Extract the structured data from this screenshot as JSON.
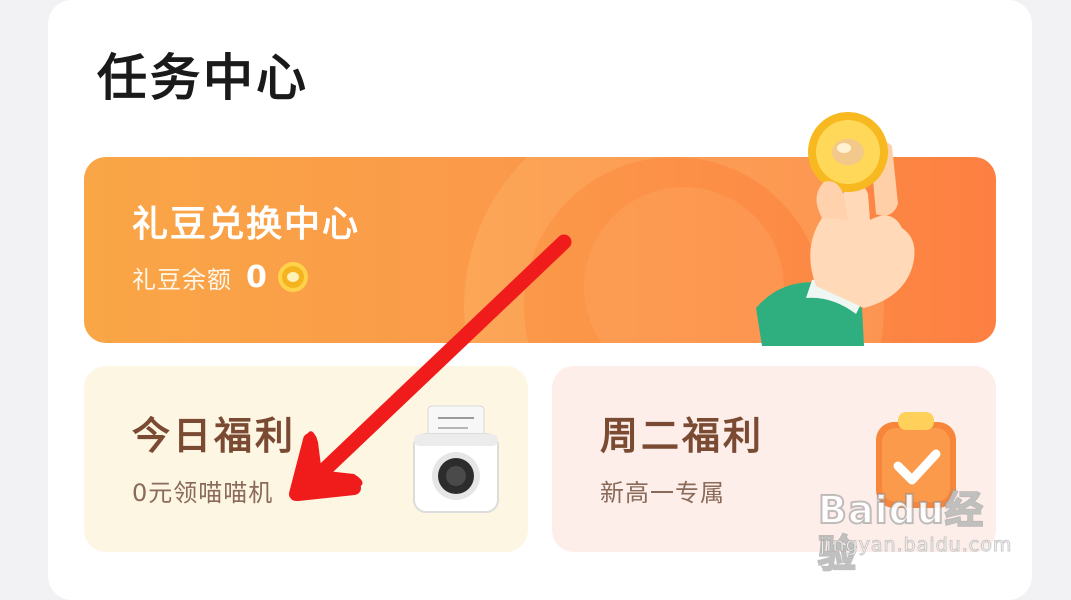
{
  "page": {
    "title": "任务中心"
  },
  "banner": {
    "title": "礼豆兑换中心",
    "balance_label": "礼豆余额",
    "balance_value": "0",
    "icons": [
      "bean-coin-icon",
      "hand-holding-coin-icon"
    ],
    "gradient": [
      "#f9a646",
      "#fd8042"
    ]
  },
  "tiles": [
    {
      "title": "今日福利",
      "subtitle": "0元领喵喵机",
      "icon": "printer-icon",
      "background": "#fdf6e3"
    },
    {
      "title": "周二福利",
      "subtitle": "新高一专属",
      "icon": "clipboard-check-icon",
      "background": "#fdeeea"
    }
  ],
  "annotation": {
    "arrow_color": "#f01c1c",
    "icon": "red-arrow-icon"
  },
  "watermark": {
    "logo": "Baidu经验",
    "url": "jingyan.baidu.com"
  }
}
